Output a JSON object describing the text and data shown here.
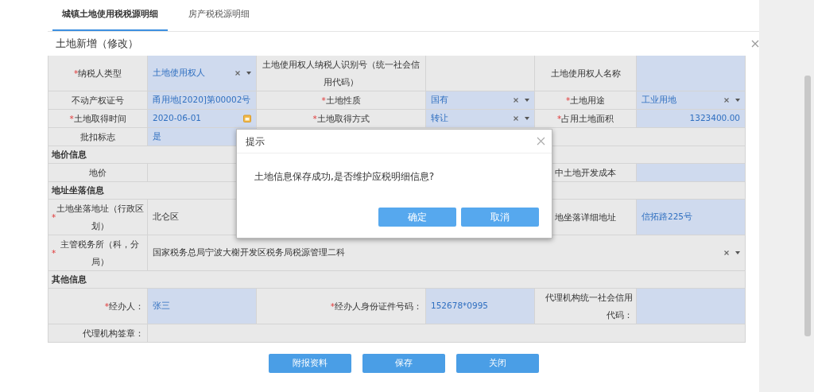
{
  "tabs": [
    {
      "label": "城镇土地使用税税源明细",
      "selected": true
    },
    {
      "label": "房产税税源明细",
      "selected": false
    }
  ],
  "form": {
    "title": "土地新增（修改）",
    "rows": [
      {
        "kind": "fields",
        "cells": [
          {
            "label": "纳税人类型",
            "mark": "*",
            "value": "土地使用权人",
            "kind": "select",
            "editable": true
          },
          {
            "label": "土地使用权人纳税人识别号（统一社会信用代码）",
            "kind": "text",
            "editable": false
          },
          {
            "label": "土地使用权人名称",
            "kind": "text",
            "editable": true
          }
        ]
      },
      {
        "kind": "fields",
        "cells": [
          {
            "label": "不动产权证号",
            "value": "甬用地[2020]第00002号",
            "kind": "text",
            "editable": true
          },
          {
            "label": "土地性质",
            "mark": "*",
            "value": "国有",
            "kind": "select",
            "editable": true
          },
          {
            "label": "土地用途",
            "mark": "*",
            "value": "工业用地",
            "kind": "select",
            "editable": true
          }
        ]
      },
      {
        "kind": "fields",
        "cells": [
          {
            "label": "土地取得时间",
            "mark": "*",
            "value": "2020-06-01",
            "kind": "date",
            "editable": true
          },
          {
            "label": "土地取得方式",
            "mark": "*",
            "value": "转让",
            "kind": "select",
            "editable": true
          },
          {
            "label": "占用土地面积",
            "mark": "*",
            "value": "1323400.00",
            "kind": "number",
            "editable": true
          }
        ]
      },
      {
        "kind": "fields",
        "cells": [
          {
            "label": "批扣标志",
            "value": "是",
            "kind": "text",
            "editable": true
          }
        ]
      },
      {
        "kind": "section",
        "title": "地价信息"
      },
      {
        "kind": "fields",
        "cells": [
          {
            "label": "地价",
            "kind": "text",
            "editable": false
          },
          {
            "kind": "covered"
          },
          {
            "label": "中土地开发成本",
            "kind": "text",
            "editable": true
          }
        ]
      },
      {
        "kind": "section",
        "title": "地址坐落信息"
      },
      {
        "kind": "fields",
        "cells": [
          {
            "label": "土地坐落地址（行政区划）",
            "mark": "*",
            "value": "北仑区",
            "kind": "text",
            "editable": false
          },
          {
            "kind": "covered"
          },
          {
            "label": "地坐落详细地址",
            "value": "信拓路225号",
            "kind": "text",
            "editable": true
          }
        ]
      },
      {
        "kind": "wide",
        "cells": [
          {
            "label": "主管税务所（科，分局）",
            "mark": "*",
            "value": "国家税务总局宁波大榭开发区税务局税源管理二科",
            "kind": "select",
            "editable": false
          }
        ]
      },
      {
        "kind": "section",
        "title": "其他信息"
      },
      {
        "kind": "rightfields",
        "cells": [
          {
            "label": "经办人：",
            "mark": "*",
            "value": "张三",
            "kind": "text",
            "editable": true
          },
          {
            "label": "经办人身份证件号码：",
            "mark": "*",
            "value": "152678*0995",
            "kind": "text",
            "editable": true
          },
          {
            "label": "代理机构统一社会信用代码：",
            "kind": "text",
            "editable": true
          }
        ]
      },
      {
        "kind": "rightwide",
        "cells": [
          {
            "label": "代理机构签章：",
            "kind": "text",
            "editable": false
          }
        ]
      }
    ],
    "buttons": [
      "附报资料",
      "保存",
      "关闭"
    ]
  },
  "dialog": {
    "title": "提示",
    "message": "土地信息保存成功,是否维护应税明细信息?",
    "buttons": [
      "确定",
      "取消"
    ]
  }
}
